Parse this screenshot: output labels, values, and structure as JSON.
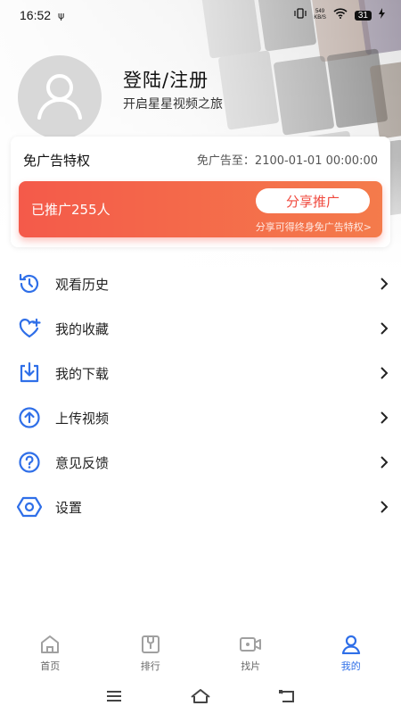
{
  "status_bar": {
    "time": "16:52",
    "usb_symbol": "ψ",
    "net_speed_value": "549",
    "net_speed_unit": "KB/S",
    "battery": "31"
  },
  "profile": {
    "title": "登陆/注册",
    "subtitle": "开启星星视频之旅"
  },
  "ad_free_card": {
    "title": "免广告特权",
    "expire_text": "免广告至：2100-01-01 00:00:00",
    "promoted_count_text": "已推广255人",
    "share_button_label": "分享推广",
    "promo_note": "分享可得终身免广告特权>"
  },
  "menu": {
    "items": [
      {
        "label": "观看历史",
        "icon": "history-icon"
      },
      {
        "label": "我的收藏",
        "icon": "heart-plus-icon"
      },
      {
        "label": "我的下载",
        "icon": "download-icon"
      },
      {
        "label": "上传视频",
        "icon": "upload-icon"
      },
      {
        "label": "意见反馈",
        "icon": "question-icon"
      },
      {
        "label": "设置",
        "icon": "settings-icon"
      }
    ]
  },
  "tabbar": {
    "tabs": [
      {
        "label": "首页",
        "icon": "home-icon",
        "active": false
      },
      {
        "label": "排行",
        "icon": "ranking-icon",
        "active": false
      },
      {
        "label": "找片",
        "icon": "video-camera-icon",
        "active": false
      },
      {
        "label": "我的",
        "icon": "user-icon",
        "active": true
      }
    ]
  },
  "colors": {
    "accent_blue": "#2f6fe8",
    "promo_red": "#f45a4a",
    "share_text": "#f0493e",
    "inactive_tab": "#a0a0a0"
  }
}
